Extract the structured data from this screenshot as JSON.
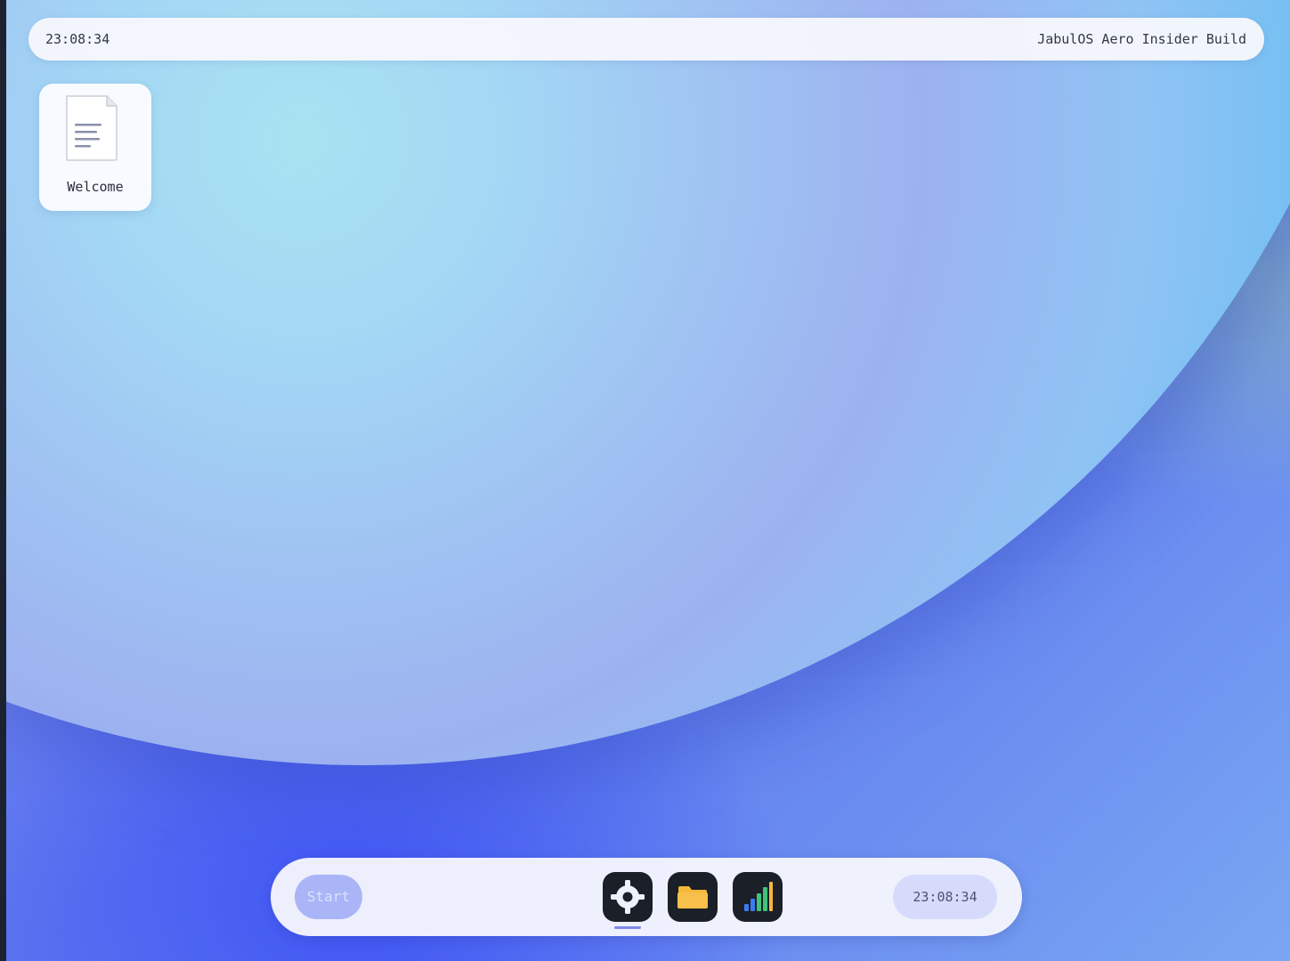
{
  "topbar": {
    "clock": "23:08:34",
    "build_label": "JabulOS Aero Insider Build"
  },
  "desktop": {
    "icons": [
      {
        "label": "Welcome",
        "icon": "document-icon"
      }
    ]
  },
  "taskbar": {
    "start_label": "Start",
    "apps": [
      {
        "name": "settings",
        "icon": "gear-icon",
        "active": true
      },
      {
        "name": "files",
        "icon": "folder-icon",
        "active": false
      },
      {
        "name": "monitor",
        "icon": "bar-chart-icon",
        "active": false
      }
    ],
    "clock": "23:08:34"
  },
  "colors": {
    "accent": "#aab5f7",
    "taskbar_clock_bg": "#d7dbfb",
    "app_tile_bg": "#1b1f27",
    "folder_yellow": "#f5b93a",
    "chart_green": "#3fc37a",
    "chart_blue": "#3b7cf2"
  }
}
